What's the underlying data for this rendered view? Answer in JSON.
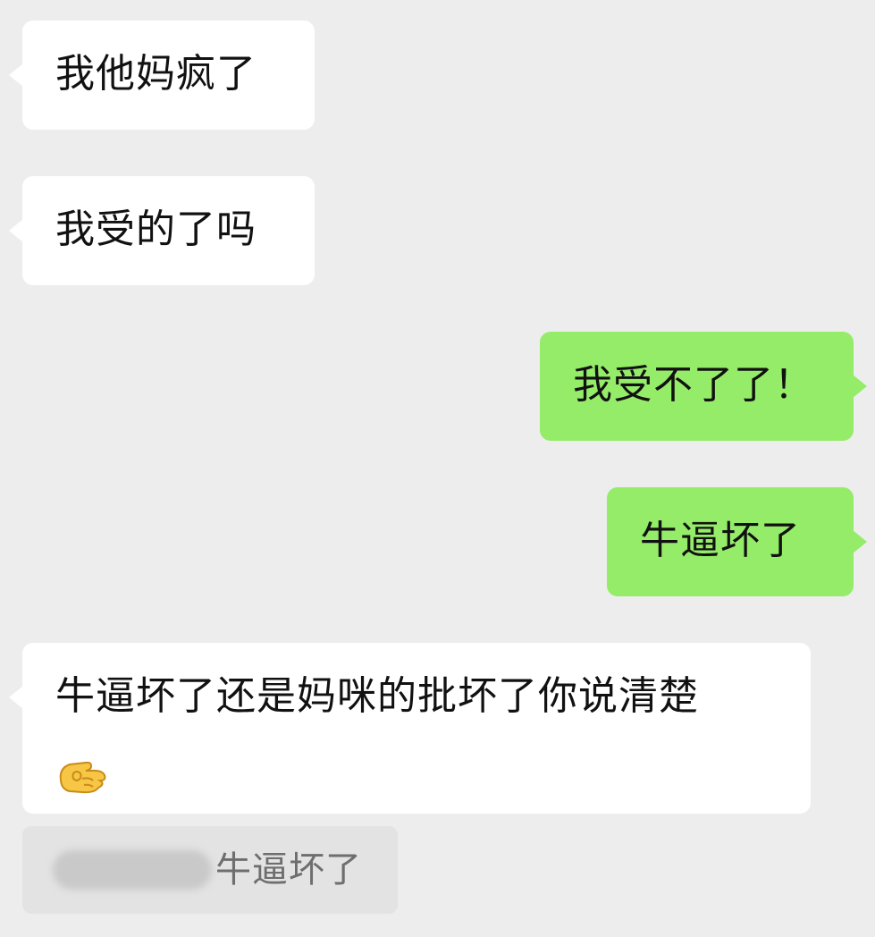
{
  "chat": {
    "messages": [
      {
        "direction": "incoming",
        "text": "我他妈疯了"
      },
      {
        "direction": "incoming",
        "text": "我受的了吗"
      },
      {
        "direction": "outgoing",
        "text": "我受不了了！"
      },
      {
        "direction": "outgoing",
        "text": "牛逼坏了"
      },
      {
        "direction": "incoming",
        "text": "牛逼坏了还是妈咪的批坏了你说清楚",
        "emoji": "pointing-hand-emoji"
      }
    ],
    "quote": {
      "sender_blurred": true,
      "text": "牛逼坏了"
    }
  },
  "colors": {
    "background": "#ededed",
    "incoming_bubble": "#ffffff",
    "outgoing_bubble": "#95ec69",
    "quote_background": "#e3e3e3",
    "quote_text": "#6e6e6e"
  }
}
